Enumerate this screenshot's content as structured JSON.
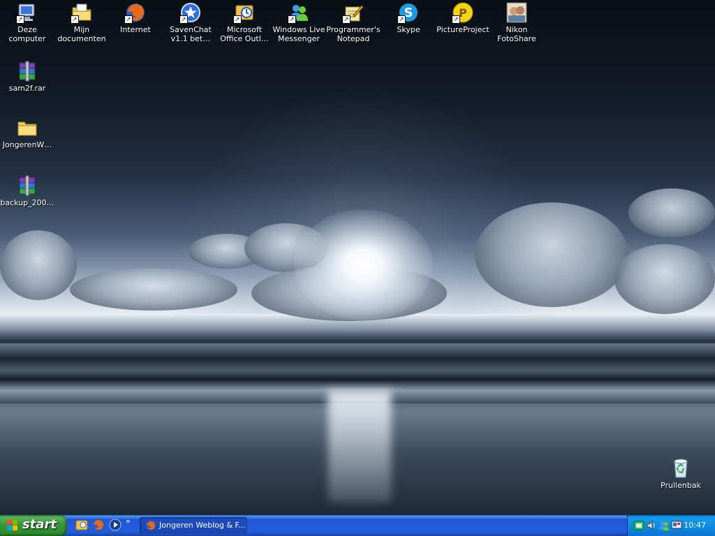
{
  "desktop_icons": [
    {
      "label": "Deze computer",
      "icon": "my-computer-icon",
      "shortcut": true
    },
    {
      "label": "Mijn\ndocumenten",
      "icon": "my-documents-icon",
      "shortcut": true
    },
    {
      "label": "Internet",
      "icon": "firefox-icon",
      "shortcut": true
    },
    {
      "label": "SavenChat\nv1.1 bet…",
      "icon": "savenchat-icon",
      "shortcut": true
    },
    {
      "label": "Microsoft\nOffice Outl…",
      "icon": "outlook-icon",
      "shortcut": true
    },
    {
      "label": "Windows Live\nMessenger",
      "icon": "messenger-icon",
      "shortcut": true
    },
    {
      "label": "Programmer's\nNotepad",
      "icon": "notepad-icon",
      "shortcut": true
    },
    {
      "label": "Skype",
      "icon": "skype-icon",
      "shortcut": true
    },
    {
      "label": "PictureProject",
      "icon": "pictureproject-icon",
      "shortcut": true
    },
    {
      "label": "Nikon\nFotoShare",
      "icon": "fotoshare-icon",
      "shortcut": false
    },
    {
      "label": "sam2f.rar",
      "icon": "winrar-archive-icon",
      "shortcut": false
    },
    {
      "label": "JongerenW…",
      "icon": "folder-icon",
      "shortcut": false
    },
    {
      "label": "backup_200…",
      "icon": "winrar-archive-icon",
      "shortcut": false
    },
    {
      "label": "Prullenbak",
      "icon": "recycle-bin-icon",
      "shortcut": false
    }
  ],
  "taskbar": {
    "start_label": "start",
    "quick_launch": [
      "outlook-icon",
      "firefox-icon",
      "media-player-icon"
    ],
    "more_label": "»",
    "task_button_label": "Jongeren Weblog & F...",
    "tray_icons": [
      "network-icon",
      "speaker-icon",
      "messenger-icon",
      "display-icon"
    ],
    "clock": "10:47"
  },
  "colors": {
    "taskbar_blue": "#245edb",
    "start_green": "#3a9a3a",
    "tray_blue": "#0e8de3"
  }
}
